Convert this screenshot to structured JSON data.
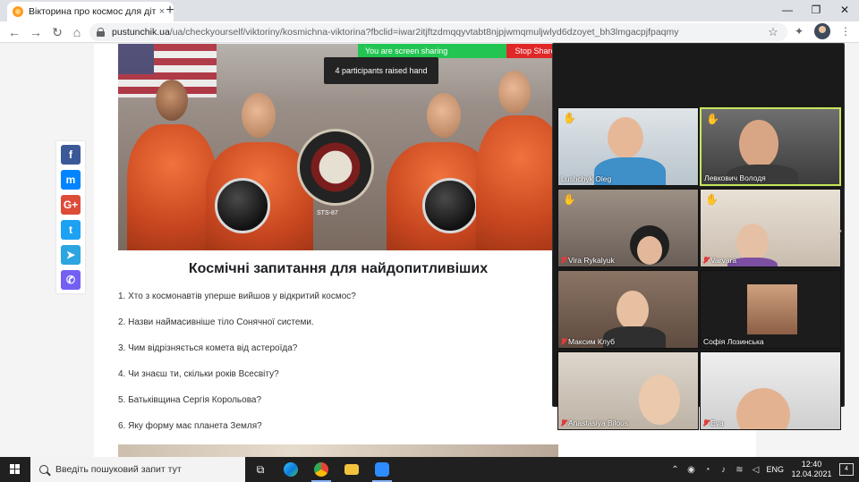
{
  "browser": {
    "tab_title": "Вікторина про космос для дітей",
    "tab_close": "×",
    "new_tab": "+",
    "url_domain": "pustunchik.ua",
    "url_path": "/ua/checkyourself/viktoriny/kosmichna-viktorina?fbclid=iwar2itjftzdmqqyvtabt8njpjwmqmuljwlyd6dzoyet_bh3lmgacpjfpaqmy",
    "window_controls": [
      "—",
      "❐",
      "✕"
    ]
  },
  "zoom": {
    "sharing_text": "You are screen sharing",
    "stop_share": "Stop Share",
    "raised_hand_notice": "4 participants raised hand",
    "participants": [
      {
        "name": "Lushchyk Oleg",
        "hand": true,
        "muted": false,
        "active": false
      },
      {
        "name": "Левкович Володя",
        "hand": true,
        "muted": false,
        "active": true
      },
      {
        "name": "Vira Rykalyuk",
        "hand": true,
        "muted": true,
        "active": false
      },
      {
        "name": "Varvara",
        "hand": true,
        "muted": true,
        "active": false
      },
      {
        "name": "Максим Клуб",
        "hand": false,
        "muted": true,
        "active": false
      },
      {
        "name": "Софія Лозинська",
        "hand": false,
        "muted": false,
        "active": false
      },
      {
        "name": "Anastasiya Bilous",
        "hand": false,
        "muted": true,
        "active": false
      },
      {
        "name": "Eva",
        "hand": false,
        "muted": true,
        "active": false
      }
    ]
  },
  "article": {
    "hero_label": "STS-87",
    "title": "Космічні запитання для найдопитливіших",
    "questions": [
      "1. Хто з космонавтів уперше вийшов у відкритий космос?",
      "2. Назви наймасивніше тіло Сонячної системи.",
      "3. Чим відрізняється комета від астероїда?",
      "4. Чи знаєш ти, скільки років Всесвіту?",
      "5. Батьківщина Сергія Корольова?",
      "6. Яку форму має планета Земля?"
    ]
  },
  "share_buttons": [
    {
      "label": "f",
      "icon": "facebook-icon",
      "color": "#3b5998"
    },
    {
      "label": "m",
      "icon": "messenger-icon",
      "color": "#0084ff"
    },
    {
      "label": "G+",
      "icon": "google-plus-icon",
      "color": "#dd4b39"
    },
    {
      "label": "t",
      "icon": "twitter-icon",
      "color": "#1da1f2"
    },
    {
      "label": "➤",
      "icon": "telegram-icon",
      "color": "#2ca5e0"
    },
    {
      "label": "✆",
      "icon": "viber-icon",
      "color": "#7360f2"
    }
  ],
  "taskbar": {
    "search_placeholder": "Введіть пошуковий запит тут",
    "language": "ENG",
    "time": "12:40",
    "date": "12.04.2021",
    "notification_count": "4"
  }
}
